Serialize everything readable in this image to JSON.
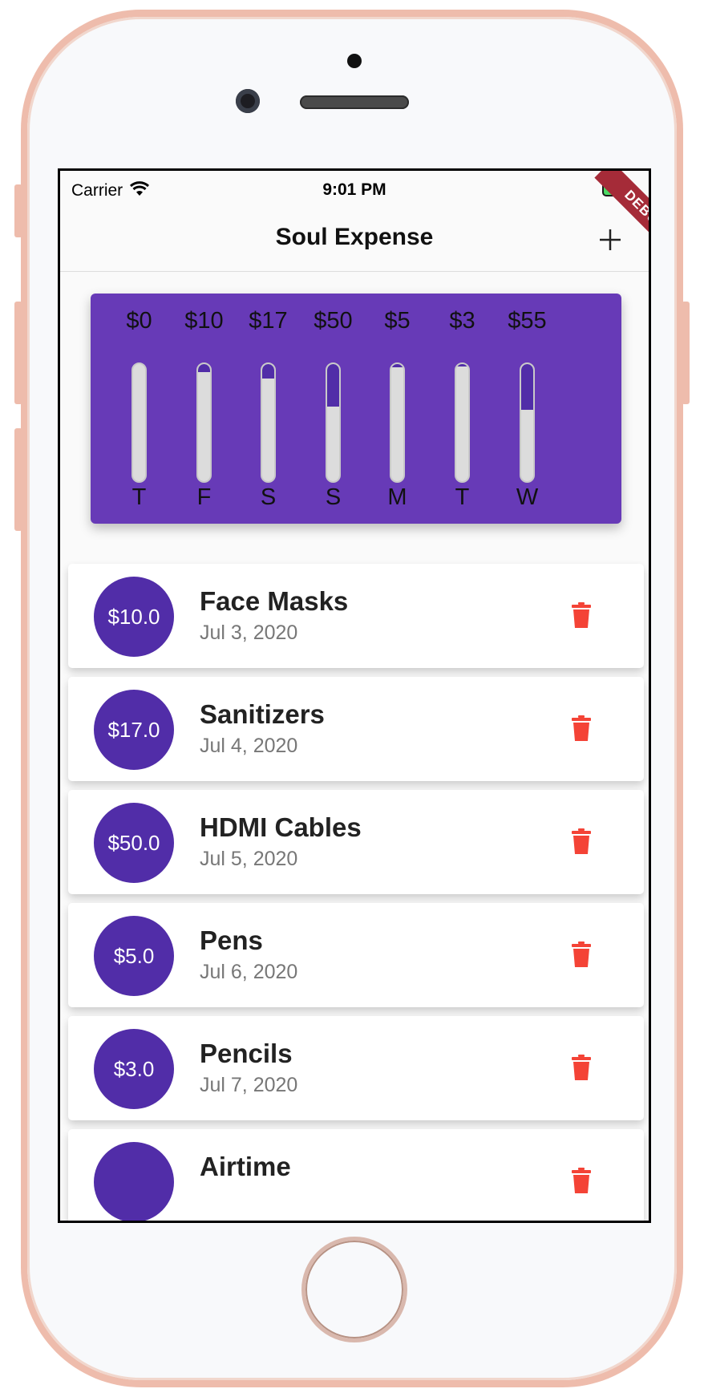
{
  "status_bar": {
    "carrier": "Carrier",
    "time": "9:01 PM"
  },
  "app_bar": {
    "title": "Soul Expense",
    "add_icon": "plus-icon",
    "debug_banner": "DEBUG"
  },
  "chart_data": {
    "type": "bar",
    "categories": [
      "T",
      "F",
      "S",
      "S",
      "M",
      "T",
      "W"
    ],
    "labels": [
      "$0",
      "$10",
      "$17",
      "$50",
      "$5",
      "$3",
      "$55"
    ],
    "values": [
      0,
      10,
      17,
      50,
      5,
      3,
      55
    ],
    "fill_fraction": [
      0,
      0.07,
      0.12,
      0.36,
      0.03,
      0.02,
      0.39
    ],
    "colors": {
      "card": "#673ab7",
      "fill": "#512da8",
      "track": "#dcdcdc"
    }
  },
  "transactions": [
    {
      "amount": "$10.0",
      "title": "Face Masks",
      "date": "Jul 3, 2020",
      "delete_icon": "trash-icon"
    },
    {
      "amount": "$17.0",
      "title": "Sanitizers",
      "date": "Jul 4, 2020",
      "delete_icon": "trash-icon"
    },
    {
      "amount": "$50.0",
      "title": "HDMI Cables",
      "date": "Jul 5, 2020",
      "delete_icon": "trash-icon"
    },
    {
      "amount": "$5.0",
      "title": "Pens",
      "date": "Jul 6, 2020",
      "delete_icon": "trash-icon"
    },
    {
      "amount": "$3.0",
      "title": "Pencils",
      "date": "Jul 7, 2020",
      "delete_icon": "trash-icon"
    },
    {
      "amount": "",
      "title": "Airtime",
      "date": "",
      "delete_icon": "trash-icon"
    }
  ],
  "colors": {
    "primary": "#673ab7",
    "accent": "#512da8",
    "delete": "#f44336"
  }
}
